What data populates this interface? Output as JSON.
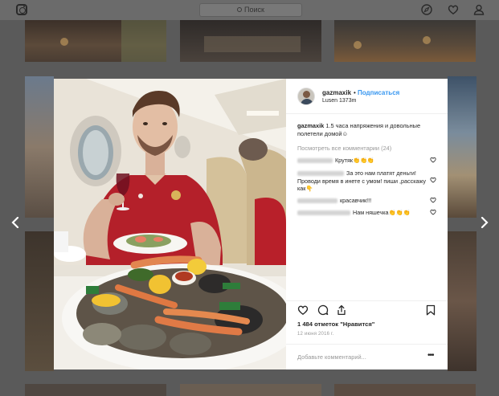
{
  "topbar": {
    "search_placeholder": "Поиск",
    "icons": [
      "instagram-icon",
      "compass-icon",
      "heart-icon",
      "profile-icon"
    ]
  },
  "post": {
    "username": "gazmaxik",
    "separator": "•",
    "follow_label": "Подписаться",
    "location": "Lusen 1373m",
    "caption_user": "gazmaxik",
    "caption_text": "1.5 часа напряжения и довольные полетели домой☺",
    "view_all_comments": "Посмотреть все комментарии (24)",
    "comments": [
      {
        "text": "Крутяк👏👏👏"
      },
      {
        "text": "За это нам платят деньги!Проводи время в инете с умом! пиши ,расскажу как👇"
      },
      {
        "text": "красавчик!!!"
      },
      {
        "text": "Нам няшечка👏👏👏"
      }
    ],
    "likes_text": "1 484 отметок \"Нравится\"",
    "date": "12 июня 2016 г.",
    "add_comment_placeholder": "Добавьте комментарий...",
    "more_label": "•••"
  },
  "colors": {
    "follow_blue": "#3897f0",
    "overlay": "#5a5a5a",
    "muted_text": "#999999"
  }
}
